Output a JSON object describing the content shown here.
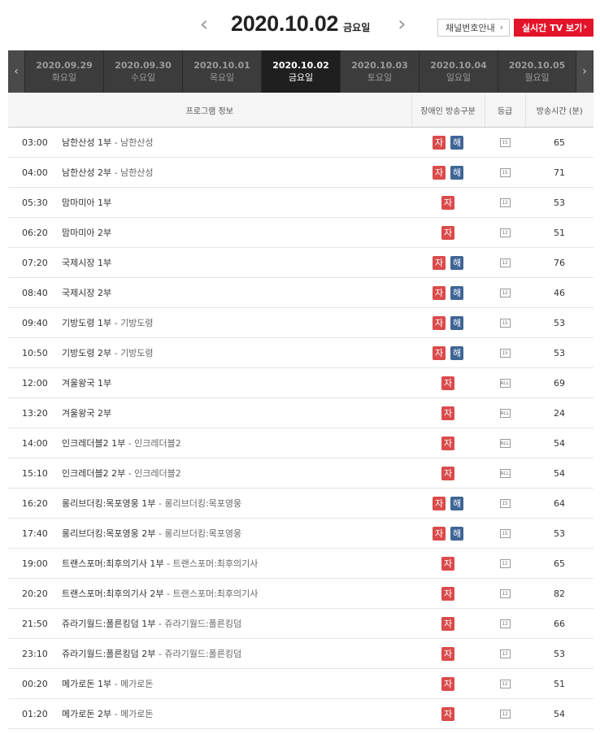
{
  "header": {
    "prev_icon": "chevron-left-icon",
    "next_icon": "chevron-right-icon",
    "current_date": "2020.10.02",
    "current_day": "금요일",
    "channel_btn": "채널번호안내",
    "live_btn": "실시간 TV 보기",
    "chevron": "›"
  },
  "date_tabs": [
    {
      "date": "2020.09.29",
      "day": "화요일",
      "active": false
    },
    {
      "date": "2020.09.30",
      "day": "수요일",
      "active": false
    },
    {
      "date": "2020.10.01",
      "day": "목요일",
      "active": false
    },
    {
      "date": "2020.10.02",
      "day": "금요일",
      "active": true
    },
    {
      "date": "2020.10.03",
      "day": "토요일",
      "active": false
    },
    {
      "date": "2020.10.04",
      "day": "일요일",
      "active": false
    },
    {
      "date": "2020.10.05",
      "day": "월요일",
      "active": false
    }
  ],
  "table": {
    "columns": [
      "프로그램 정보",
      "장애인 방송구분",
      "등급",
      "방송시간 (분)"
    ],
    "badge_ja": "자",
    "badge_hae": "해",
    "rows": [
      {
        "time": "03:00",
        "title": "남한산성 1부",
        "sub": " - 남한산성",
        "ja": true,
        "hae": true,
        "grade": "15",
        "dur": "65"
      },
      {
        "time": "04:00",
        "title": "남한산성 2부",
        "sub": " - 남한산성",
        "ja": true,
        "hae": true,
        "grade": "15",
        "dur": "71"
      },
      {
        "time": "05:30",
        "title": "맘마미아 1부",
        "sub": "",
        "ja": true,
        "hae": false,
        "grade": "12",
        "dur": "53"
      },
      {
        "time": "06:20",
        "title": "맘마미아 2부",
        "sub": "",
        "ja": true,
        "hae": false,
        "grade": "12",
        "dur": "51"
      },
      {
        "time": "07:20",
        "title": "국제시장 1부",
        "sub": "",
        "ja": true,
        "hae": true,
        "grade": "12",
        "dur": "76"
      },
      {
        "time": "08:40",
        "title": "국제시장 2부",
        "sub": "",
        "ja": true,
        "hae": true,
        "grade": "12",
        "dur": "46"
      },
      {
        "time": "09:40",
        "title": "기방도령 1부",
        "sub": " - 기방도령",
        "ja": true,
        "hae": true,
        "grade": "15",
        "dur": "53"
      },
      {
        "time": "10:50",
        "title": "기방도령 2부",
        "sub": " - 기방도령",
        "ja": true,
        "hae": true,
        "grade": "15",
        "dur": "53"
      },
      {
        "time": "12:00",
        "title": "겨울왕국 1부",
        "sub": "",
        "ja": true,
        "hae": false,
        "grade": "ALL",
        "dur": "69"
      },
      {
        "time": "13:20",
        "title": "겨울왕국 2부",
        "sub": "",
        "ja": true,
        "hae": false,
        "grade": "ALL",
        "dur": "24"
      },
      {
        "time": "14:00",
        "title": "인크레더블2 1부",
        "sub": " - 인크레더블2",
        "ja": true,
        "hae": false,
        "grade": "ALL",
        "dur": "54"
      },
      {
        "time": "15:10",
        "title": "인크레더블2 2부",
        "sub": " - 인크레더블2",
        "ja": true,
        "hae": false,
        "grade": "ALL",
        "dur": "54"
      },
      {
        "time": "16:20",
        "title": "롱리브더킹:목포영웅 1부",
        "sub": " - 롱리브더킹:목포영웅",
        "ja": true,
        "hae": true,
        "grade": "15",
        "dur": "64"
      },
      {
        "time": "17:40",
        "title": "롱리브더킹:목포영웅 2부",
        "sub": " - 롱리브더킹:목포영웅",
        "ja": true,
        "hae": true,
        "grade": "15",
        "dur": "53"
      },
      {
        "time": "19:00",
        "title": "트랜스포머:최후의기사 1부",
        "sub": " - 트랜스포머:최후의기사",
        "ja": true,
        "hae": false,
        "grade": "12",
        "dur": "65"
      },
      {
        "time": "20:20",
        "title": "트랜스포머:최후의기사 2부",
        "sub": " - 트랜스포머:최후의기사",
        "ja": true,
        "hae": false,
        "grade": "12",
        "dur": "82"
      },
      {
        "time": "21:50",
        "title": "쥬라기월드:폴른킹덤 1부",
        "sub": " - 쥬라기월드:폴른킹덤",
        "ja": true,
        "hae": false,
        "grade": "12",
        "dur": "66"
      },
      {
        "time": "23:10",
        "title": "쥬라기월드:폴른킹덤 2부",
        "sub": " - 쥬라기월드:폴른킹덤",
        "ja": true,
        "hae": false,
        "grade": "12",
        "dur": "53"
      },
      {
        "time": "00:20",
        "title": "메가로돈 1부",
        "sub": " - 메가로돈",
        "ja": true,
        "hae": false,
        "grade": "12",
        "dur": "51"
      },
      {
        "time": "01:20",
        "title": "메가로돈 2부",
        "sub": " - 메가로돈",
        "ja": true,
        "hae": false,
        "grade": "12",
        "dur": "54"
      }
    ]
  }
}
